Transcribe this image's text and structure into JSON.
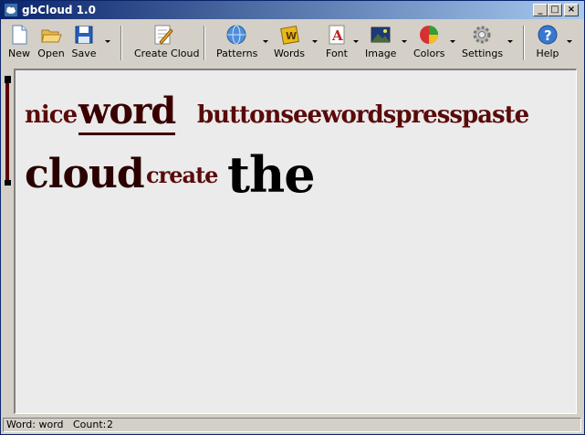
{
  "window": {
    "title": "gbCloud 1.0"
  },
  "toolbar": {
    "new": "New",
    "open": "Open",
    "save": "Save",
    "create_cloud": "Create Cloud",
    "patterns": "Patterns",
    "words": "Words",
    "font": "Font",
    "image": "Image",
    "colors": "Colors",
    "settings": "Settings",
    "help": "Help"
  },
  "cloud": {
    "words": [
      {
        "text": "nice",
        "color": "#5a0a0a"
      },
      {
        "text": "word",
        "color": "#3a0000",
        "selected": true
      },
      {
        "text": "buttonseewordspresspaste",
        "color": "#5a0a0a"
      },
      {
        "text": "cloud",
        "color": "#2a0000"
      },
      {
        "text": "create",
        "color": "#5a0a0a"
      },
      {
        "text": "the",
        "color": "#000000"
      }
    ]
  },
  "status": {
    "word_label": "Word: word",
    "count_label": "Count:",
    "count_value": "2"
  }
}
